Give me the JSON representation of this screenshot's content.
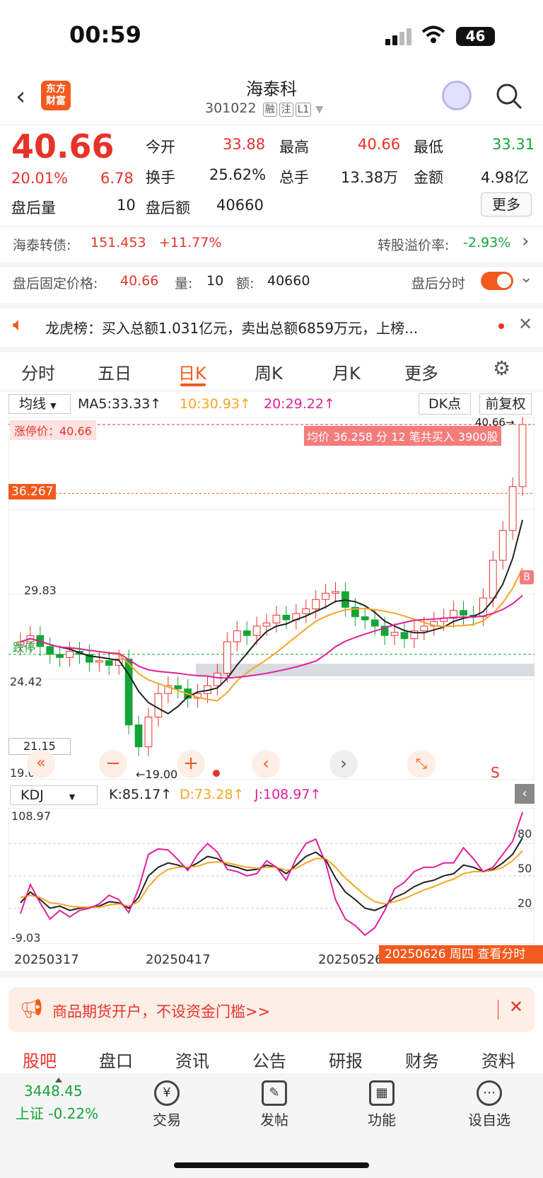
{
  "status_bar": {
    "time": "00:59",
    "battery": "46"
  },
  "nav": {
    "logo": "东方\n财富",
    "title": "海泰科",
    "code": "301022",
    "tags": [
      "融",
      "注",
      "L1"
    ]
  },
  "quote": {
    "price": "40.66",
    "change_pct": "20.01%",
    "change": "6.78",
    "open_label": "今开",
    "open": "33.88",
    "high_label": "最高",
    "high": "40.66",
    "low_label": "最低",
    "low": "33.31",
    "turnover_label": "换手",
    "turnover": "25.62%",
    "volume_label": "总手",
    "volume": "13.38万",
    "amount_label": "金额",
    "amount": "4.98亿",
    "after_vol_label": "盘后量",
    "after_vol": "10",
    "after_amt_label": "盘后额",
    "after_amt": "40660",
    "more_label": "更多"
  },
  "convertible": {
    "label": "海泰转债:",
    "price": "151.453",
    "pct": "+11.77%",
    "premium_label": "转股溢价率:",
    "premium": "-2.93%"
  },
  "after_hours": {
    "price_label": "盘后固定价格:",
    "price": "40.66",
    "vol_label": "量:",
    "vol": "10",
    "amt_label": "额:",
    "amt": "40660",
    "switch_label": "盘后分时"
  },
  "dragon": {
    "text": "龙虎榜：买入总额1.031亿元，卖出总额6859万元，上榜..."
  },
  "tabs": [
    "分时",
    "五日",
    "日K",
    "周K",
    "月K",
    "更多"
  ],
  "chart_toolbar": {
    "indicator": "均线",
    "ma5": "MA5:33.33↑",
    "ma10": "10:30.93↑",
    "ma20": "20:29.22↑",
    "dk": "DK点",
    "adjust": "前复权"
  },
  "colors": {
    "accent": "#f25a1e",
    "up": "#e6332a",
    "down": "#13a538",
    "ma5": "#222222",
    "ma10": "#f5a623",
    "ma20": "#e0219b"
  },
  "chart_data": [
    {
      "type": "candlestick",
      "title": "日K",
      "ylim": [
        19.0,
        40.66
      ],
      "y_ticks": [
        "40.66",
        "36.267",
        "29.83",
        "24.42",
        "21.15",
        "19.00"
      ],
      "annotations": [
        "涨停价：40.66",
        "均价 36.258 分 12 笔共买入 3900股",
        "40.66→",
        "跌停",
        "←19.00",
        "B",
        "S"
      ],
      "x": [
        "20250317",
        "20250417",
        "20250526",
        "20250626"
      ],
      "ma5_last": 33.33,
      "ma10_last": 30.93,
      "ma20_last": 29.22,
      "close_series": [
        26.8,
        27.2,
        26.5,
        26.0,
        25.8,
        26.2,
        26.0,
        25.5,
        25.6,
        25.3,
        25.7,
        21.5,
        20.1,
        22.0,
        23.5,
        24.0,
        23.8,
        23.2,
        23.5,
        24.0,
        24.8,
        26.8,
        27.5,
        27.2,
        27.8,
        28.0,
        28.5,
        28.2,
        28.6,
        28.9,
        29.5,
        29.9,
        30.0,
        29.0,
        28.4,
        28.2,
        27.8,
        27.2,
        27.4,
        27.0,
        27.5,
        27.8,
        28.1,
        28.3,
        28.8,
        28.5,
        28.4,
        29.6,
        32.0,
        33.9,
        36.7,
        40.66
      ]
    },
    {
      "type": "line",
      "title": "KDJ",
      "labels": {
        "k": "K:85.17↑",
        "d": "D:73.28↑",
        "j": "J:108.97↑"
      },
      "ylim": [
        -9.03,
        108.97
      ],
      "y_ticks": [
        "108.97",
        "80",
        "50",
        "20",
        "-9.03"
      ],
      "series": [
        {
          "name": "K",
          "values": [
            25,
            35,
            28,
            20,
            22,
            18,
            20,
            21,
            22,
            26,
            25,
            20,
            30,
            50,
            58,
            62,
            60,
            57,
            62,
            68,
            66,
            60,
            58,
            55,
            56,
            60,
            58,
            52,
            60,
            68,
            72,
            65,
            48,
            35,
            28,
            20,
            18,
            22,
            30,
            34,
            40,
            44,
            46,
            50,
            52,
            60,
            58,
            54,
            56,
            62,
            70,
            85.17
          ]
        },
        {
          "name": "D",
          "values": [
            30,
            32,
            30,
            25,
            24,
            22,
            21,
            21,
            21,
            23,
            24,
            22,
            26,
            40,
            50,
            56,
            58,
            58,
            59,
            62,
            63,
            62,
            60,
            58,
            57,
            58,
            58,
            55,
            57,
            62,
            66,
            66,
            58,
            48,
            40,
            32,
            26,
            24,
            26,
            29,
            33,
            37,
            40,
            44,
            47,
            52,
            54,
            54,
            55,
            58,
            64,
            73.28
          ]
        },
        {
          "name": "J",
          "values": [
            15,
            42,
            25,
            10,
            18,
            12,
            18,
            20,
            24,
            32,
            28,
            16,
            38,
            70,
            75,
            74,
            65,
            55,
            70,
            80,
            72,
            56,
            54,
            50,
            52,
            64,
            58,
            46,
            66,
            80,
            84,
            62,
            28,
            10,
            4,
            -5,
            2,
            18,
            38,
            44,
            54,
            58,
            58,
            62,
            62,
            76,
            66,
            54,
            58,
            70,
            82,
            108.97
          ]
        }
      ],
      "x_labels": [
        "20250317",
        "20250417",
        "20250526"
      ],
      "tooltip": "20250626 周四 查看分时"
    }
  ],
  "ad": {
    "text": "商品期货开户，不设资金门槛>>"
  },
  "bottom_tabs": [
    "股吧",
    "盘口",
    "资讯",
    "公告",
    "研报",
    "财务",
    "资料"
  ],
  "dock": {
    "index_value": "3448.45",
    "index_label": "上证 -0.22%",
    "items": [
      "交易",
      "发帖",
      "功能",
      "设自选"
    ]
  }
}
